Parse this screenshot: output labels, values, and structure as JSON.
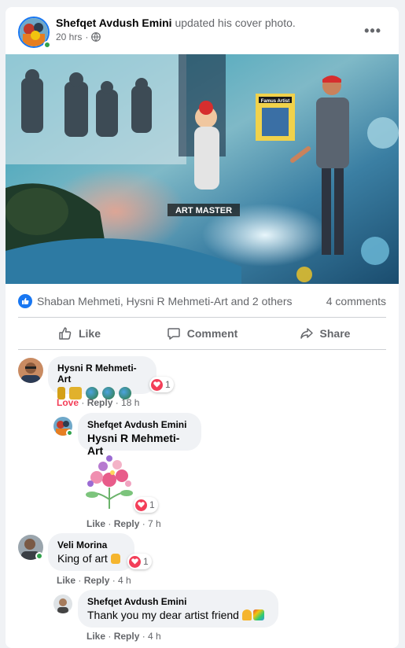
{
  "post": {
    "author": "Shefqet Avdush Emini",
    "action": "updated his cover photo.",
    "time": "20 hrs",
    "more_label": "•••"
  },
  "cover": {
    "caption": "ART MASTER",
    "badge": "Famus Artist"
  },
  "reactions": {
    "names": "Shaban Mehmeti, Hysni R Mehmeti-Art and 2 others",
    "comments": "4 comments"
  },
  "actions": {
    "like": "Like",
    "comment": "Comment",
    "share": "Share"
  },
  "comments": [
    {
      "author": "Hysni R Mehmeti-Art",
      "reaction_count": "1",
      "meta": {
        "love": "Love",
        "reply": "Reply",
        "time": "18 h"
      }
    },
    {
      "author": "Shefqet Avdush Emini",
      "text": "Hysni R Mehmeti-Art",
      "reaction_count": "1",
      "meta": {
        "like": "Like",
        "reply": "Reply",
        "time": "7 h"
      }
    },
    {
      "author": "Veli Morina",
      "text": "King of art",
      "reaction_count": "1",
      "meta": {
        "like": "Like",
        "reply": "Reply",
        "time": "4 h"
      }
    },
    {
      "author": "Shefqet Avdush Emini",
      "text": "Thank you my dear artist friend",
      "meta": {
        "like": "Like",
        "reply": "Reply",
        "time": "4 h"
      }
    }
  ],
  "colors": {
    "brand": "#1877f2",
    "love": "#f33e58",
    "online": "#31a24c"
  }
}
